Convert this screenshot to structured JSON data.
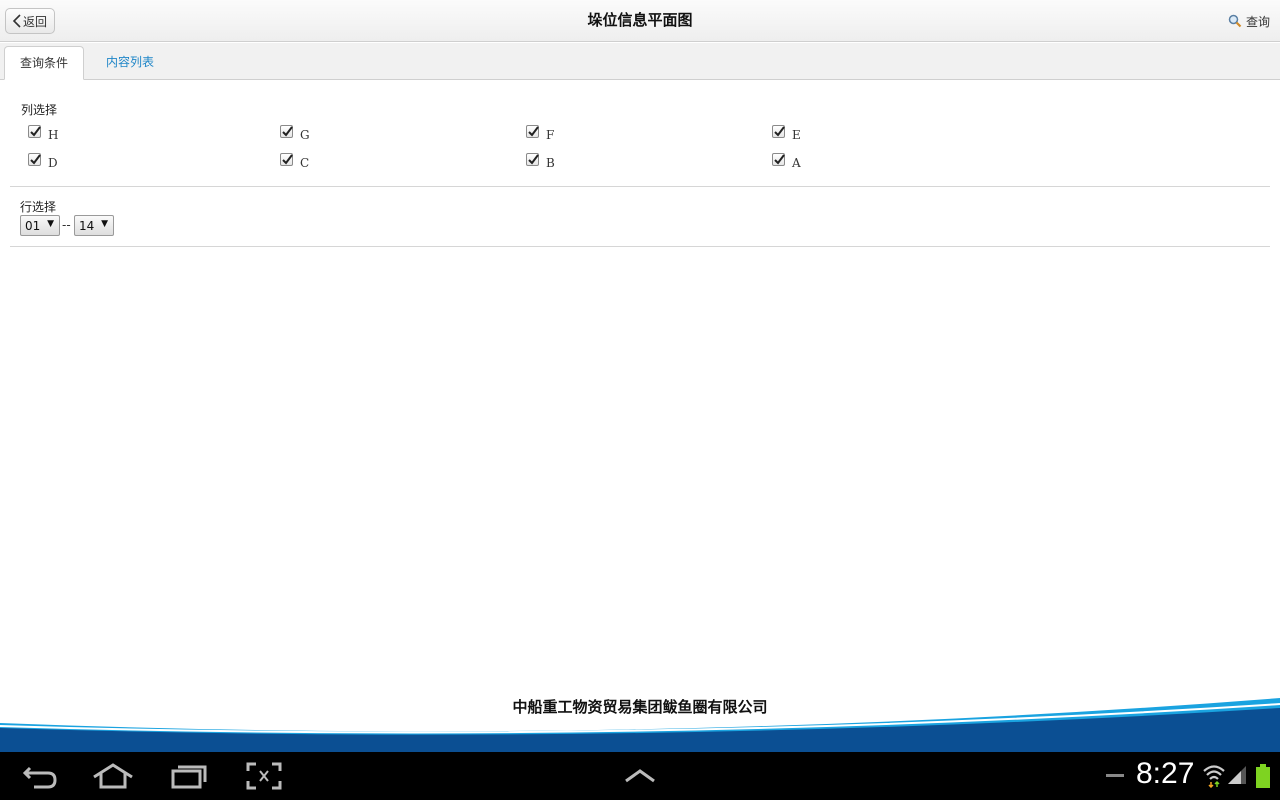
{
  "header": {
    "back_label": "返回",
    "title": "垛位信息平面图",
    "query_label": "查询"
  },
  "tabs": [
    {
      "label": "查询条件",
      "active": true
    },
    {
      "label": "内容列表",
      "active": false
    }
  ],
  "column_select": {
    "label": "列选择",
    "options": [
      {
        "label": "H",
        "checked": true
      },
      {
        "label": "G",
        "checked": true
      },
      {
        "label": "F",
        "checked": true
      },
      {
        "label": "E",
        "checked": true
      },
      {
        "label": "D",
        "checked": true
      },
      {
        "label": "C",
        "checked": true
      },
      {
        "label": "B",
        "checked": true
      },
      {
        "label": "A",
        "checked": true
      }
    ]
  },
  "row_select": {
    "label": "行选择",
    "from": "01",
    "separator": "--",
    "to": "14"
  },
  "footer": {
    "company": "中船重工物资贸易集团鲅鱼圈有限公司"
  },
  "system_bar": {
    "time": "8:27"
  },
  "colors": {
    "accent": "#1f86c8",
    "wave_dark": "#0b4f93",
    "wave_light": "#1aa3e0",
    "battery": "#7ed321"
  }
}
